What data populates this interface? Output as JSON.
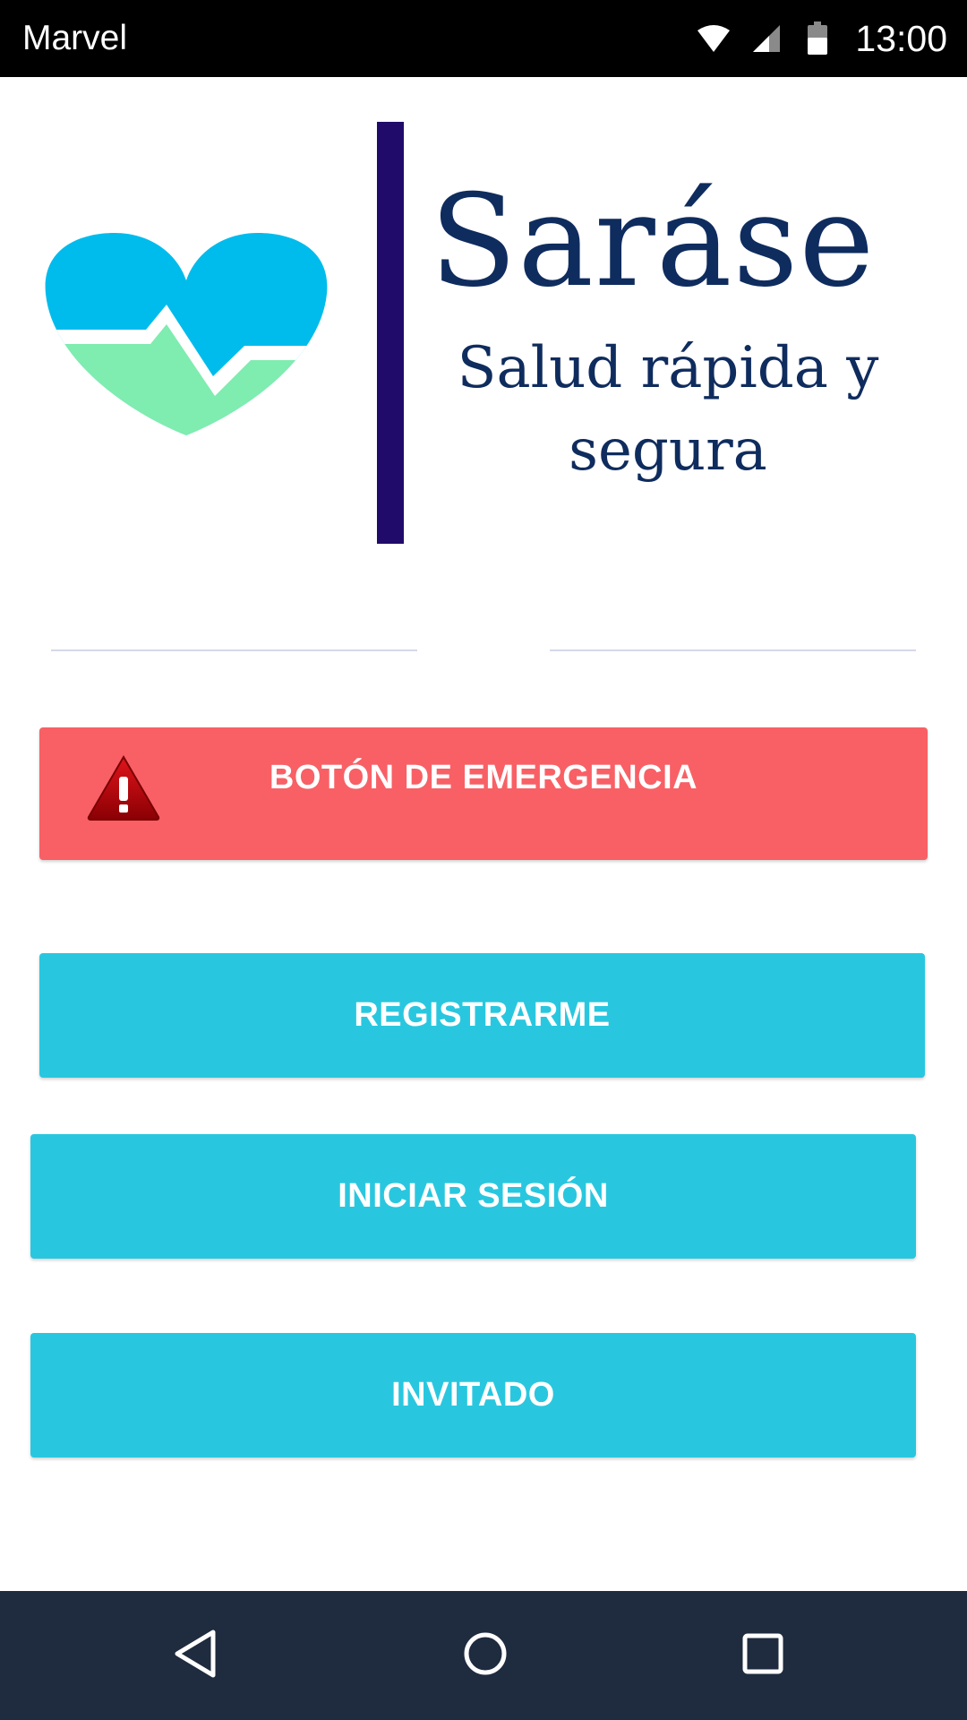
{
  "status_bar": {
    "app_name": "Marvel",
    "time": "13:00",
    "icons": [
      "wifi-icon",
      "signal-icon",
      "battery-icon"
    ]
  },
  "brand": {
    "title": "Saráse",
    "tagline": "Salud rápida y segura",
    "logo_icon": "heart-pulse-icon",
    "colors": {
      "heart_top": "#00bcec",
      "heart_bottom": "#7fecb0",
      "divider": "#200b6b",
      "text": "#0f2c5e"
    }
  },
  "buttons": {
    "emergency": {
      "label": "BOTÓN DE EMERGENCIA",
      "icon": "warning-icon",
      "color": "#f86065"
    },
    "register": {
      "label": "REGISTRARME",
      "color": "#29c7df"
    },
    "login": {
      "label": "INICIAR SESIÓN",
      "color": "#29c7df"
    },
    "guest": {
      "label": "INVITADO",
      "color": "#29c7df"
    }
  },
  "navigation_bar": {
    "items": [
      "back-icon",
      "home-icon",
      "recent-apps-icon"
    ],
    "color": "#1f2b3e"
  }
}
